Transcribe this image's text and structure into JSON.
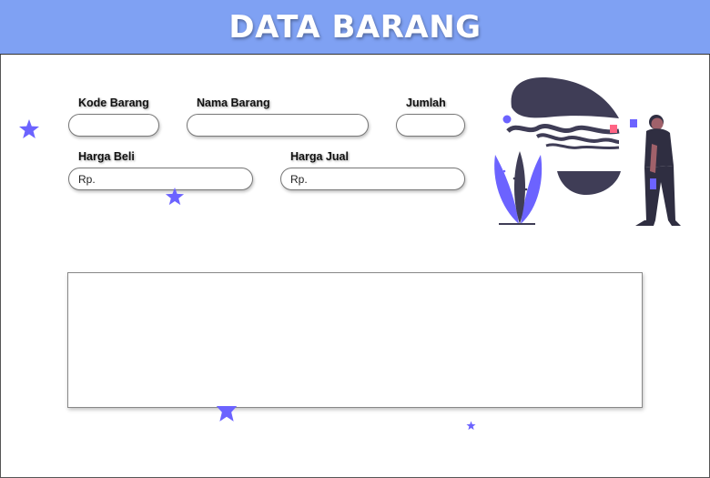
{
  "header": {
    "title": "DATA BARANG"
  },
  "form": {
    "kode_barang": {
      "label": "Kode Barang",
      "value": "",
      "placeholder": ""
    },
    "nama_barang": {
      "label": "Nama Barang",
      "value": "",
      "placeholder": ""
    },
    "jumlah": {
      "label": "Jumlah",
      "value": "",
      "placeholder": ""
    },
    "harga_beli": {
      "label": "Harga Beli",
      "value": "",
      "placeholder": "Rp."
    },
    "harga_jual": {
      "label": "Harga Jual",
      "value": "",
      "placeholder": "Rp."
    }
  },
  "table": {
    "rows": []
  },
  "colors": {
    "header_bg": "#7fa1f3",
    "accent_purple": "#6c63ff",
    "dark": "#3f3d56",
    "pink": "#ff6584"
  },
  "icons": [
    "star-icon",
    "person-illustration",
    "plant-icon"
  ]
}
